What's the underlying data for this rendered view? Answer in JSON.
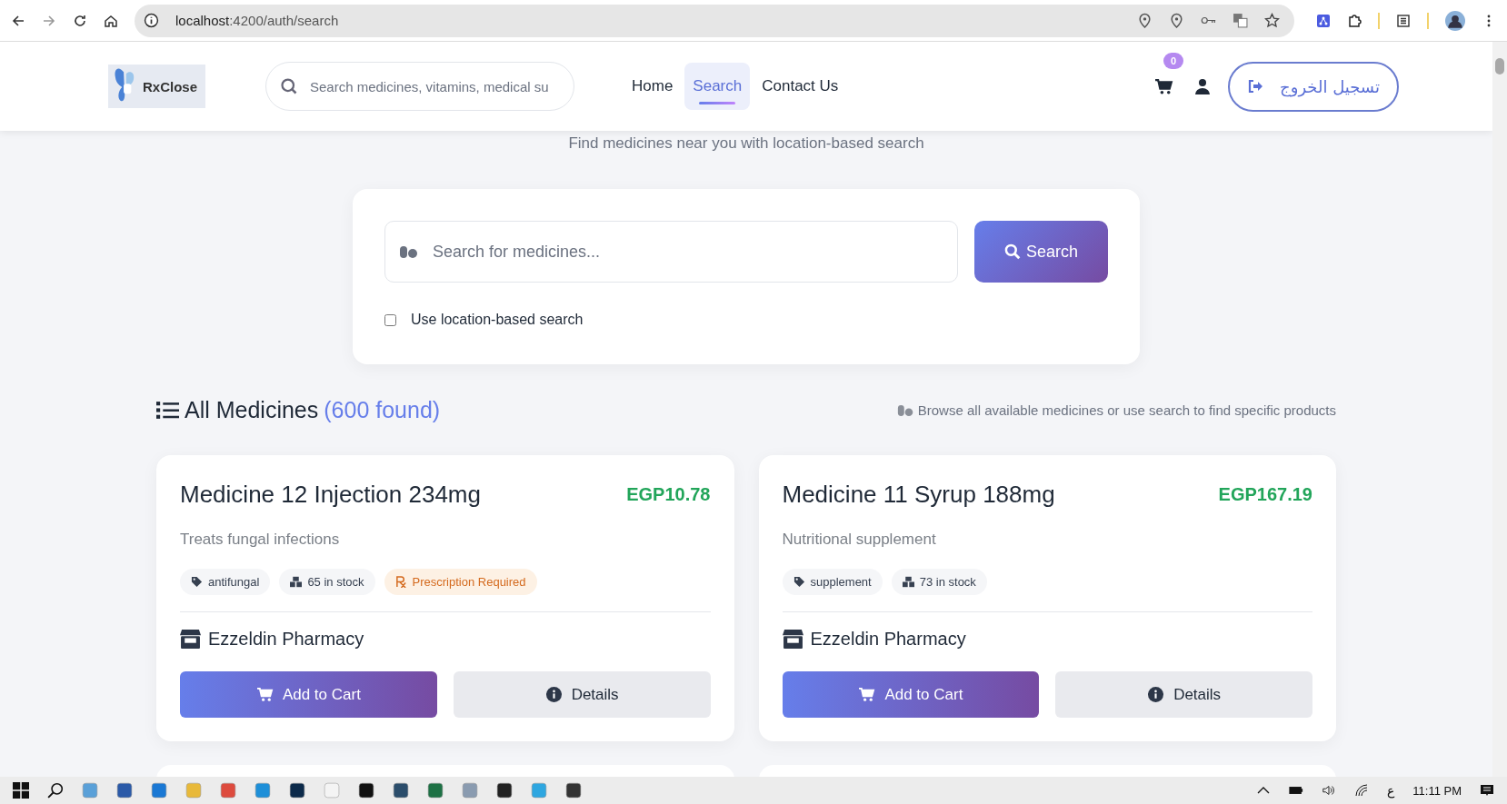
{
  "browser": {
    "url_host": "localhost",
    "url_path": ":4200/auth/search"
  },
  "header": {
    "brand": "RxClose",
    "search_placeholder": "Search medicines, vitamins, medical su",
    "nav": [
      {
        "label": "Home",
        "selected": false
      },
      {
        "label": "Search",
        "selected": true
      },
      {
        "label": "Contact Us",
        "selected": false
      }
    ],
    "cart_count": "0",
    "logout": "تسجيل الخروج"
  },
  "subtitle": "Find medicines near you with location-based search",
  "search": {
    "placeholder": "Search for medicines...",
    "button": "Search",
    "location_label": "Use location-based search",
    "location_checked": false
  },
  "section": {
    "title": "All Medicines",
    "count": "(600 found)",
    "hint": "Browse all available medicines or use search to find specific products"
  },
  "cards": [
    {
      "name": "Medicine 12 Injection 234mg",
      "price": "EGP10.78",
      "description": "Treats fungal infections",
      "tags": [
        {
          "kind": "category",
          "label": "antifungal"
        },
        {
          "kind": "stock",
          "label": "65 in stock"
        },
        {
          "kind": "prescription",
          "label": "Prescription Required"
        }
      ],
      "pharmacy": "Ezzeldin Pharmacy",
      "add": "Add to Cart",
      "details": "Details"
    },
    {
      "name": "Medicine 11 Syrup 188mg",
      "price": "EGP167.19",
      "description": "Nutritional supplement",
      "tags": [
        {
          "kind": "category",
          "label": "supplement"
        },
        {
          "kind": "stock",
          "label": "73 in stock"
        }
      ],
      "pharmacy": "Ezzeldin Pharmacy",
      "add": "Add to Cart",
      "details": "Details"
    }
  ],
  "taskbar": {
    "language": "ع",
    "time": "11:11 PM"
  }
}
